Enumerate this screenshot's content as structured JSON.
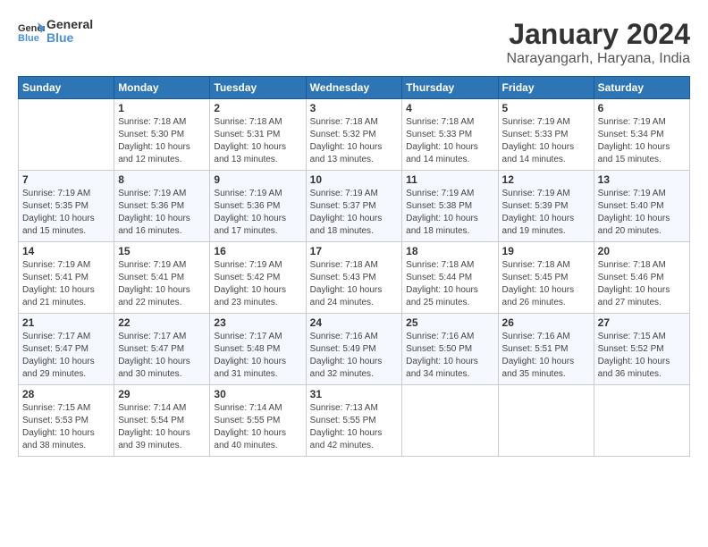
{
  "header": {
    "logo_line1": "General",
    "logo_line2": "Blue",
    "month": "January 2024",
    "location": "Narayangarh, Haryana, India"
  },
  "weekdays": [
    "Sunday",
    "Monday",
    "Tuesday",
    "Wednesday",
    "Thursday",
    "Friday",
    "Saturday"
  ],
  "weeks": [
    [
      {
        "day": "",
        "sunrise": "",
        "sunset": "",
        "daylight": ""
      },
      {
        "day": "1",
        "sunrise": "Sunrise: 7:18 AM",
        "sunset": "Sunset: 5:30 PM",
        "daylight": "Daylight: 10 hours and 12 minutes."
      },
      {
        "day": "2",
        "sunrise": "Sunrise: 7:18 AM",
        "sunset": "Sunset: 5:31 PM",
        "daylight": "Daylight: 10 hours and 13 minutes."
      },
      {
        "day": "3",
        "sunrise": "Sunrise: 7:18 AM",
        "sunset": "Sunset: 5:32 PM",
        "daylight": "Daylight: 10 hours and 13 minutes."
      },
      {
        "day": "4",
        "sunrise": "Sunrise: 7:18 AM",
        "sunset": "Sunset: 5:33 PM",
        "daylight": "Daylight: 10 hours and 14 minutes."
      },
      {
        "day": "5",
        "sunrise": "Sunrise: 7:19 AM",
        "sunset": "Sunset: 5:33 PM",
        "daylight": "Daylight: 10 hours and 14 minutes."
      },
      {
        "day": "6",
        "sunrise": "Sunrise: 7:19 AM",
        "sunset": "Sunset: 5:34 PM",
        "daylight": "Daylight: 10 hours and 15 minutes."
      }
    ],
    [
      {
        "day": "7",
        "sunrise": "Sunrise: 7:19 AM",
        "sunset": "Sunset: 5:35 PM",
        "daylight": "Daylight: 10 hours and 15 minutes."
      },
      {
        "day": "8",
        "sunrise": "Sunrise: 7:19 AM",
        "sunset": "Sunset: 5:36 PM",
        "daylight": "Daylight: 10 hours and 16 minutes."
      },
      {
        "day": "9",
        "sunrise": "Sunrise: 7:19 AM",
        "sunset": "Sunset: 5:36 PM",
        "daylight": "Daylight: 10 hours and 17 minutes."
      },
      {
        "day": "10",
        "sunrise": "Sunrise: 7:19 AM",
        "sunset": "Sunset: 5:37 PM",
        "daylight": "Daylight: 10 hours and 18 minutes."
      },
      {
        "day": "11",
        "sunrise": "Sunrise: 7:19 AM",
        "sunset": "Sunset: 5:38 PM",
        "daylight": "Daylight: 10 hours and 18 minutes."
      },
      {
        "day": "12",
        "sunrise": "Sunrise: 7:19 AM",
        "sunset": "Sunset: 5:39 PM",
        "daylight": "Daylight: 10 hours and 19 minutes."
      },
      {
        "day": "13",
        "sunrise": "Sunrise: 7:19 AM",
        "sunset": "Sunset: 5:40 PM",
        "daylight": "Daylight: 10 hours and 20 minutes."
      }
    ],
    [
      {
        "day": "14",
        "sunrise": "Sunrise: 7:19 AM",
        "sunset": "Sunset: 5:41 PM",
        "daylight": "Daylight: 10 hours and 21 minutes."
      },
      {
        "day": "15",
        "sunrise": "Sunrise: 7:19 AM",
        "sunset": "Sunset: 5:41 PM",
        "daylight": "Daylight: 10 hours and 22 minutes."
      },
      {
        "day": "16",
        "sunrise": "Sunrise: 7:19 AM",
        "sunset": "Sunset: 5:42 PM",
        "daylight": "Daylight: 10 hours and 23 minutes."
      },
      {
        "day": "17",
        "sunrise": "Sunrise: 7:18 AM",
        "sunset": "Sunset: 5:43 PM",
        "daylight": "Daylight: 10 hours and 24 minutes."
      },
      {
        "day": "18",
        "sunrise": "Sunrise: 7:18 AM",
        "sunset": "Sunset: 5:44 PM",
        "daylight": "Daylight: 10 hours and 25 minutes."
      },
      {
        "day": "19",
        "sunrise": "Sunrise: 7:18 AM",
        "sunset": "Sunset: 5:45 PM",
        "daylight": "Daylight: 10 hours and 26 minutes."
      },
      {
        "day": "20",
        "sunrise": "Sunrise: 7:18 AM",
        "sunset": "Sunset: 5:46 PM",
        "daylight": "Daylight: 10 hours and 27 minutes."
      }
    ],
    [
      {
        "day": "21",
        "sunrise": "Sunrise: 7:17 AM",
        "sunset": "Sunset: 5:47 PM",
        "daylight": "Daylight: 10 hours and 29 minutes."
      },
      {
        "day": "22",
        "sunrise": "Sunrise: 7:17 AM",
        "sunset": "Sunset: 5:47 PM",
        "daylight": "Daylight: 10 hours and 30 minutes."
      },
      {
        "day": "23",
        "sunrise": "Sunrise: 7:17 AM",
        "sunset": "Sunset: 5:48 PM",
        "daylight": "Daylight: 10 hours and 31 minutes."
      },
      {
        "day": "24",
        "sunrise": "Sunrise: 7:16 AM",
        "sunset": "Sunset: 5:49 PM",
        "daylight": "Daylight: 10 hours and 32 minutes."
      },
      {
        "day": "25",
        "sunrise": "Sunrise: 7:16 AM",
        "sunset": "Sunset: 5:50 PM",
        "daylight": "Daylight: 10 hours and 34 minutes."
      },
      {
        "day": "26",
        "sunrise": "Sunrise: 7:16 AM",
        "sunset": "Sunset: 5:51 PM",
        "daylight": "Daylight: 10 hours and 35 minutes."
      },
      {
        "day": "27",
        "sunrise": "Sunrise: 7:15 AM",
        "sunset": "Sunset: 5:52 PM",
        "daylight": "Daylight: 10 hours and 36 minutes."
      }
    ],
    [
      {
        "day": "28",
        "sunrise": "Sunrise: 7:15 AM",
        "sunset": "Sunset: 5:53 PM",
        "daylight": "Daylight: 10 hours and 38 minutes."
      },
      {
        "day": "29",
        "sunrise": "Sunrise: 7:14 AM",
        "sunset": "Sunset: 5:54 PM",
        "daylight": "Daylight: 10 hours and 39 minutes."
      },
      {
        "day": "30",
        "sunrise": "Sunrise: 7:14 AM",
        "sunset": "Sunset: 5:55 PM",
        "daylight": "Daylight: 10 hours and 40 minutes."
      },
      {
        "day": "31",
        "sunrise": "Sunrise: 7:13 AM",
        "sunset": "Sunset: 5:55 PM",
        "daylight": "Daylight: 10 hours and 42 minutes."
      },
      {
        "day": "",
        "sunrise": "",
        "sunset": "",
        "daylight": ""
      },
      {
        "day": "",
        "sunrise": "",
        "sunset": "",
        "daylight": ""
      },
      {
        "day": "",
        "sunrise": "",
        "sunset": "",
        "daylight": ""
      }
    ]
  ]
}
